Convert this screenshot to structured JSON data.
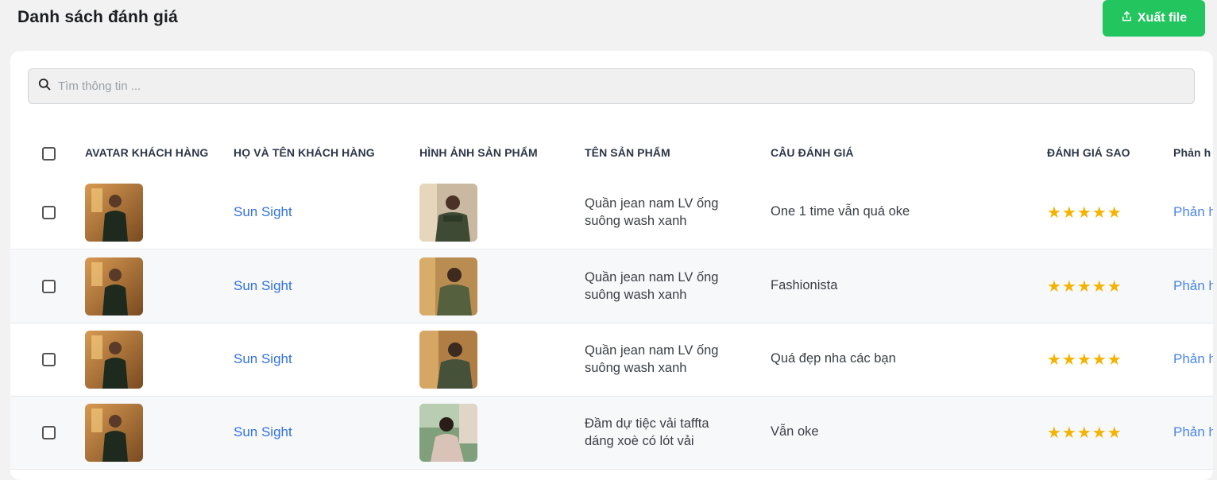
{
  "header": {
    "title": "Danh sách đánh giá",
    "export_label": "Xuất file",
    "export_icon": "upload-icon"
  },
  "search": {
    "placeholder": "Tìm thông tin ...",
    "value": "",
    "icon": "search-icon"
  },
  "table": {
    "columns": [
      "AVATAR KHÁCH HÀNG",
      "HỌ VÀ TÊN KHÁCH HÀNG",
      "HÌNH ẢNH SẢN PHẨM",
      "TÊN SẢN PHẨM",
      "CÂU ĐÁNH GIÁ",
      "ĐÁNH GIÁ SAO",
      "Phản h"
    ],
    "rows": [
      {
        "customer_name": "Sun Sight",
        "product_name": "Quần jean nam LV ống suông wash xanh",
        "review": "One 1 time vẫn quá oke",
        "stars": 5,
        "stars_text": "★★★★★",
        "reply": "Phản h",
        "product_image": "man-photo"
      },
      {
        "customer_name": "Sun Sight",
        "product_name": "Quần jean nam LV ống suông wash xanh",
        "review": "Fashionista",
        "stars": 5,
        "stars_text": "★★★★★",
        "reply": "Phản h",
        "product_image": "man-photo"
      },
      {
        "customer_name": "Sun Sight",
        "product_name": "Quần jean nam LV ống suông wash xanh",
        "review": "Quá đẹp nha các bạn",
        "stars": 5,
        "stars_text": "★★★★★",
        "reply": "Phản h",
        "product_image": "man-photo"
      },
      {
        "customer_name": "Sun Sight",
        "product_name": "Đầm dự tiệc vải taffta dáng xoè có lót vải",
        "review": "Vẫn oke",
        "stars": 5,
        "stars_text": "★★★★★",
        "reply": "Phản h",
        "product_image": "woman-photo"
      }
    ]
  },
  "colors": {
    "accent_green": "#22c55e",
    "link_blue": "#2f6fe0",
    "star": "#f5b301"
  }
}
